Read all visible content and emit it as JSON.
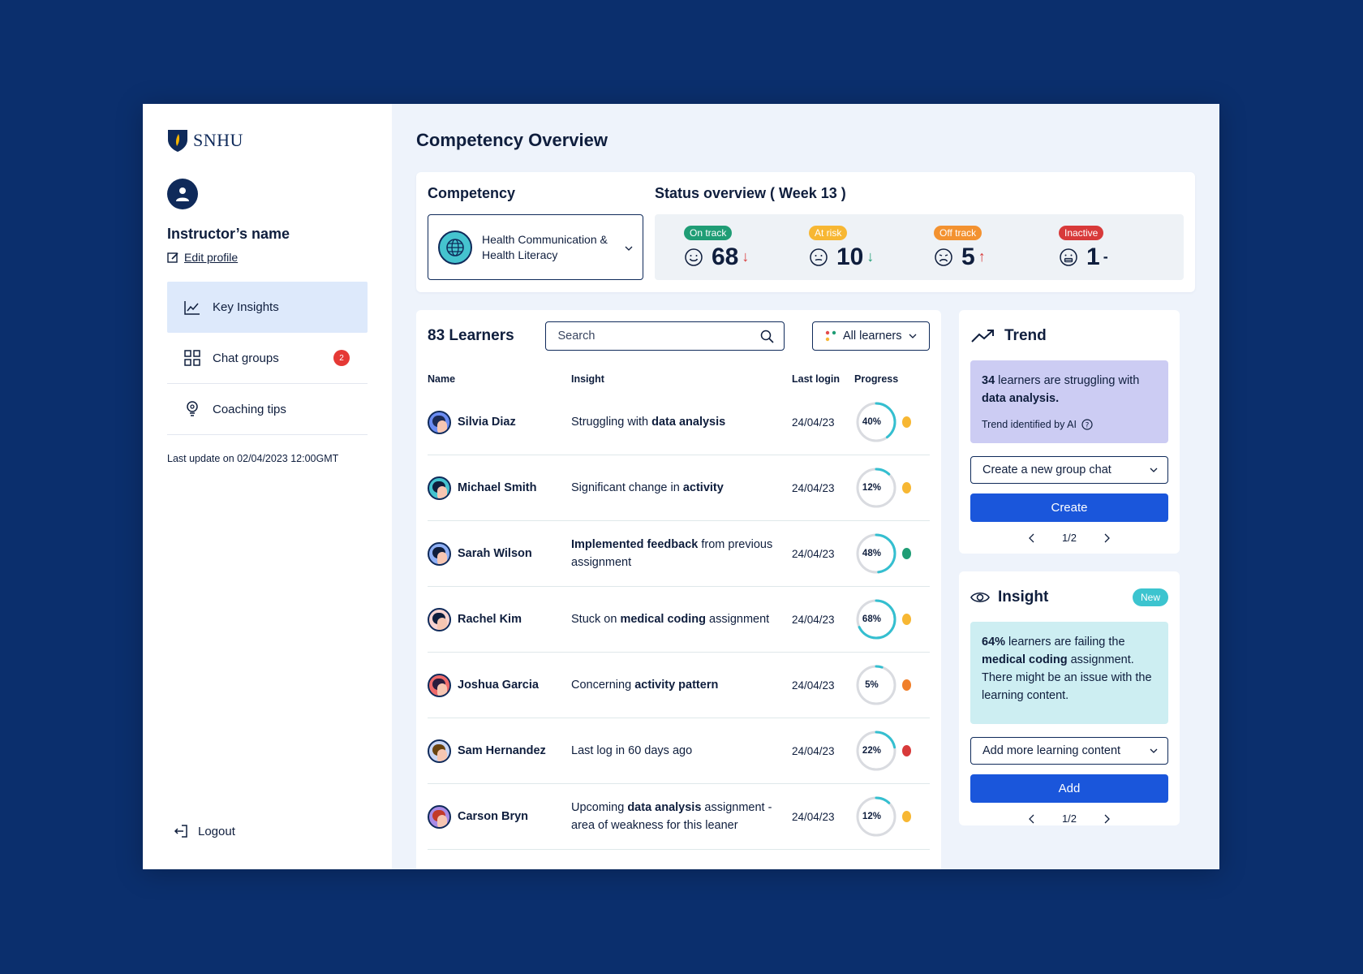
{
  "brand": {
    "name": "SNHU"
  },
  "sidebar": {
    "instructor_name": "Instructor’s name",
    "edit_profile": "Edit profile",
    "items": [
      {
        "label": "Key Insights",
        "icon": "line-chart-icon",
        "active": true
      },
      {
        "label": "Chat groups",
        "icon": "grid-icon",
        "badge": "2"
      },
      {
        "label": "Coaching tips",
        "icon": "lightbulb-icon"
      }
    ],
    "last_update": "Last update on 02/04/2023 12:00GMT",
    "logout": "Logout"
  },
  "main": {
    "title": "Competency Overview",
    "competency": {
      "heading": "Competency",
      "selected": "Health Communication & Health Literacy"
    },
    "status": {
      "heading": "Status overview ( Week 13 )",
      "items": [
        {
          "label": "On track",
          "value": "68",
          "trend": "down",
          "arrow": "↓",
          "pill_color": "#1f9d75",
          "arrow_color": "#d83a3a"
        },
        {
          "label": "At risk",
          "value": "10",
          "trend": "down",
          "arrow": "↓",
          "pill_color": "#f7b733",
          "arrow_color": "#1f9d75"
        },
        {
          "label": "Off track",
          "value": "5",
          "trend": "up",
          "arrow": "↑",
          "pill_color": "#f39230",
          "arrow_color": "#d83a3a"
        },
        {
          "label": "Inactive",
          "value": "1",
          "trend": "none",
          "arrow": "-",
          "pill_color": "#d83a3a",
          "arrow_color": "#0f1e3d"
        }
      ]
    },
    "learners": {
      "title": "83 Learners",
      "search_placeholder": "Search",
      "filter_label": "All learners",
      "columns": {
        "name": "Name",
        "insight": "Insight",
        "last_login": "Last login",
        "progress": "Progress"
      },
      "rows": [
        {
          "name": "Silvia Diaz",
          "insight_pre": "Struggling with ",
          "insight_bold": "data analysis",
          "insight_post": "",
          "last_login": "24/04/23",
          "progress_label": "40%",
          "progress": 40,
          "status_color": "#f7b733",
          "avatar_bg": "#6b8cf2",
          "hair": "#1b2a55"
        },
        {
          "name": "Michael Smith",
          "insight_pre": "Significant change in ",
          "insight_bold": "activity",
          "insight_post": "",
          "last_login": "24/04/23",
          "progress_label": "12%",
          "progress": 12,
          "status_color": "#f7b733",
          "avatar_bg": "#43c3cf",
          "hair": "#0f1e3d"
        },
        {
          "name": "Sarah Wilson",
          "insight_pre": "",
          "insight_bold": "Implemented feedback",
          "insight_post": " from previous assignment",
          "last_login": "24/04/23",
          "progress_label": "48%",
          "progress": 48,
          "status_color": "#1f9d75",
          "avatar_bg": "#8fb0f5",
          "hair": "#0f1e3d"
        },
        {
          "name": "Rachel Kim",
          "insight_pre": "Stuck on ",
          "insight_bold": "medical coding",
          "insight_post": " assignment",
          "last_login": "24/04/23",
          "progress_label": "68%",
          "progress": 68,
          "status_color": "#f7b733",
          "avatar_bg": "#f8d3d0",
          "hair": "#0f1e3d"
        },
        {
          "name": "Joshua Garcia",
          "insight_pre": "Concerning ",
          "insight_bold": "activity pattern",
          "insight_post": "",
          "last_login": "24/04/23",
          "progress_label": "5%",
          "progress": 5,
          "status_color": "#f07f2a",
          "avatar_bg": "#ef6a6a",
          "hair": "#2a1c3d"
        },
        {
          "name": "Sam Hernandez",
          "insight_pre": "Last log in 60 days ago",
          "insight_bold": "",
          "insight_post": "",
          "last_login": "24/04/23",
          "progress_label": "22%",
          "progress": 22,
          "status_color": "#d83a3a",
          "avatar_bg": "#c9d6f5",
          "hair": "#6a4410"
        },
        {
          "name": "Carson Bryn",
          "insight_pre": "Upcoming ",
          "insight_bold": "data analysis",
          "insight_post": " assignment - area of weakness for this leaner",
          "last_login": "24/04/23",
          "progress_label": "12%",
          "progress": 12,
          "status_color": "#f7b733",
          "avatar_bg": "#a98be6",
          "hair": "#c23a2a"
        }
      ]
    },
    "trend": {
      "title": "Trend",
      "count": "34",
      "text_mid": " learners are struggling with ",
      "topic": "data analysis.",
      "ai_note": "Trend identified by AI",
      "select_label": "Create a new group chat",
      "button": "Create",
      "pager": "1/2"
    },
    "insight": {
      "title": "Insight",
      "badge": "New",
      "percent": "64%",
      "text_mid": " learners are failing the ",
      "topic": "medical coding",
      "text_post": " assignment. There might be an issue with the learning content.",
      "select_label": "Add more learning content",
      "button": "Add",
      "pager": "1/2"
    }
  },
  "colors": {
    "accent": "#1a56db",
    "navy": "#0f2a5a",
    "teal": "#3cc4cf",
    "background": "#0b2f6d"
  }
}
